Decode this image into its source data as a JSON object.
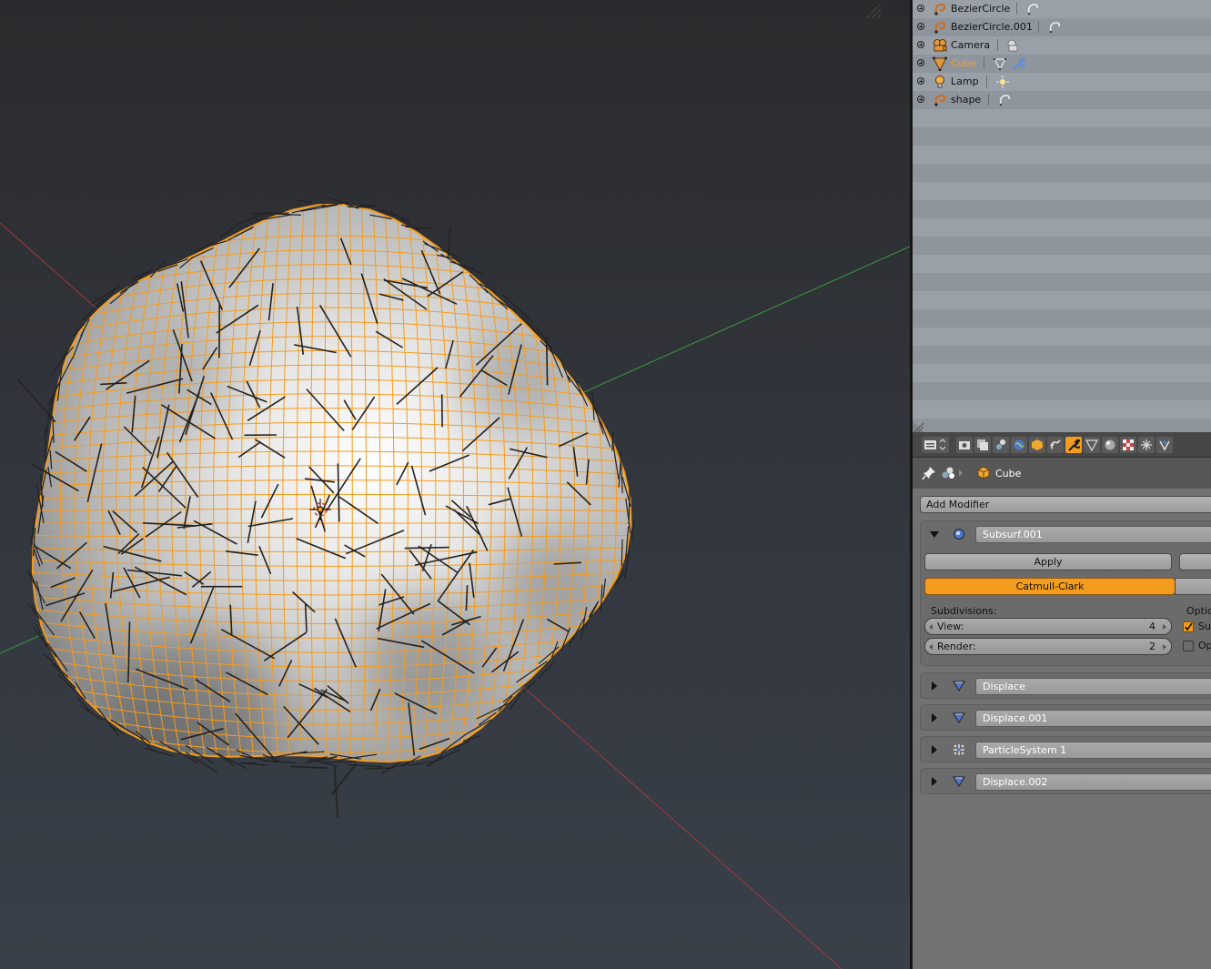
{
  "colors": {
    "selection": "#ff9a1f",
    "wire": "#f39c1e",
    "x_axis": "#a33a3a",
    "y_axis": "#3a9a3a"
  },
  "outliner": {
    "items": [
      {
        "name": "BezierCircle",
        "icon": "curve-icon",
        "data_icon": "curve-data-icon",
        "selected": false
      },
      {
        "name": "BezierCircle.001",
        "icon": "curve-icon",
        "data_icon": "curve-data-icon",
        "selected": false
      },
      {
        "name": "Camera",
        "icon": "camera-icon",
        "data_icon": "camera-data-icon",
        "selected": false
      },
      {
        "name": "Cube",
        "icon": "mesh-icon",
        "data_icon": "mesh-data-icon",
        "selected": true
      },
      {
        "name": "Lamp",
        "icon": "lamp-icon",
        "data_icon": "lamp-data-icon",
        "selected": false
      },
      {
        "name": "shape",
        "icon": "curve-icon",
        "data_icon": "curve-data-icon",
        "selected": false
      }
    ]
  },
  "properties": {
    "tabs": [
      "render",
      "render-layers",
      "scene",
      "world",
      "object",
      "constraints",
      "modifiers",
      "data",
      "material",
      "texture",
      "particles",
      "physics"
    ],
    "active_tab": "modifiers",
    "context_object": "Cube",
    "add_modifier_label": "Add Modifier",
    "subsurf": {
      "name": "Subsurf.001",
      "apply_label": "Apply",
      "algorithm": "Catmull-Clark",
      "subdivisions_label": "Subdivisions:",
      "options_label": "Optio",
      "view_label": "View:",
      "view_value": "4",
      "render_label": "Render:",
      "render_value": "2",
      "opt1_label": "Su",
      "opt1_checked": true,
      "opt2_label": "Op",
      "opt2_checked": false
    },
    "modifiers": [
      {
        "name": "Displace",
        "icon": "displace-icon"
      },
      {
        "name": "Displace.001",
        "icon": "displace-icon"
      },
      {
        "name": "ParticleSystem 1",
        "icon": "particles-icon"
      },
      {
        "name": "Displace.002",
        "icon": "displace-icon"
      }
    ]
  }
}
